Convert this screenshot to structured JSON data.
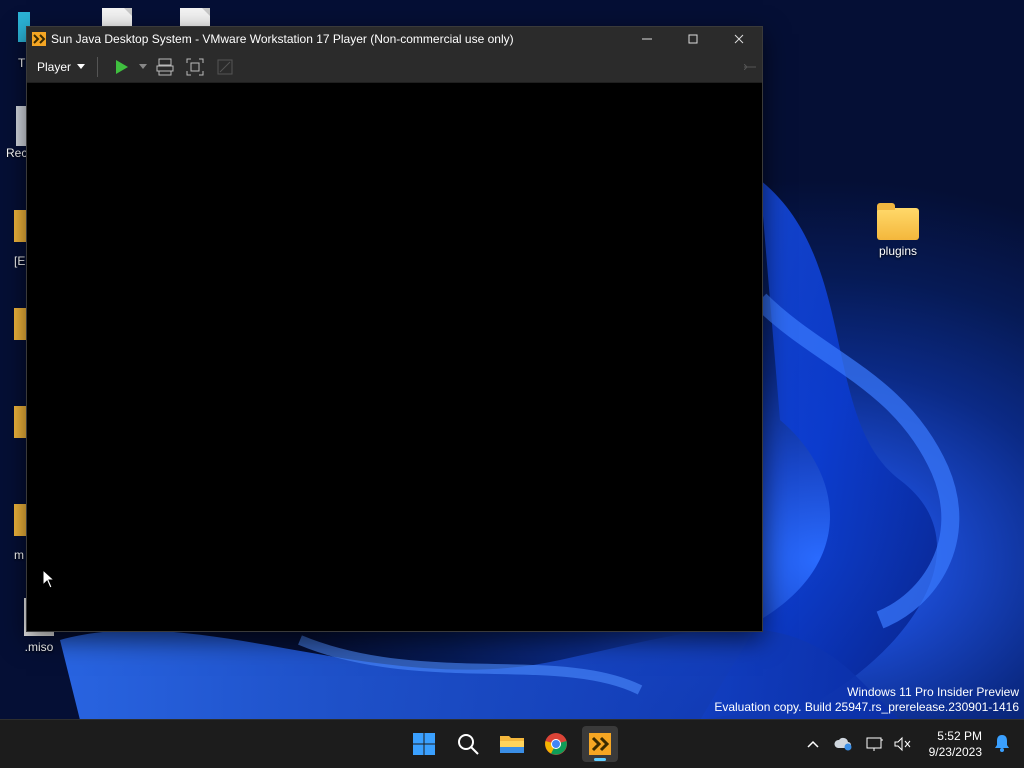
{
  "desktop": {
    "icons": [
      {
        "label": "plugins",
        "type": "folder"
      },
      {
        "label": ".miso",
        "type": "file"
      },
      {
        "label": "Rec",
        "type": "recycle"
      },
      {
        "label": "T",
        "type": "partial"
      },
      {
        "label": "[E",
        "type": "partial"
      },
      {
        "label": "m",
        "type": "partial"
      }
    ]
  },
  "window": {
    "title": "Sun Java Desktop System - VMware Workstation 17 Player (Non-commercial use only)",
    "menu_label": "Player",
    "icons": {
      "app": "vmware-icon",
      "play": "play-icon",
      "dropdown": "chevron-down-icon",
      "send_cad": "send-ctrl-alt-del-icon",
      "fullscreen": "fullscreen-icon",
      "unity": "unity-icon"
    }
  },
  "watermark": {
    "line1": "Windows 11 Pro Insider Preview",
    "line2": "Evaluation copy. Build 25947.rs_prerelease.230901-1416"
  },
  "taskbar": {
    "apps": [
      "start-icon",
      "search-icon",
      "file-explorer-icon",
      "chrome-icon",
      "vmware-icon"
    ],
    "tray_icons": [
      "chevron-up-icon",
      "onedrive-icon",
      "network-icon",
      "volume-muted-icon",
      "notification-bell-icon"
    ],
    "time": "5:52 PM",
    "date": "9/23/2023"
  },
  "colors": {
    "accent": "#60cdff",
    "play_green": "#3fbf3f",
    "vmware_orange": "#f5a623"
  }
}
